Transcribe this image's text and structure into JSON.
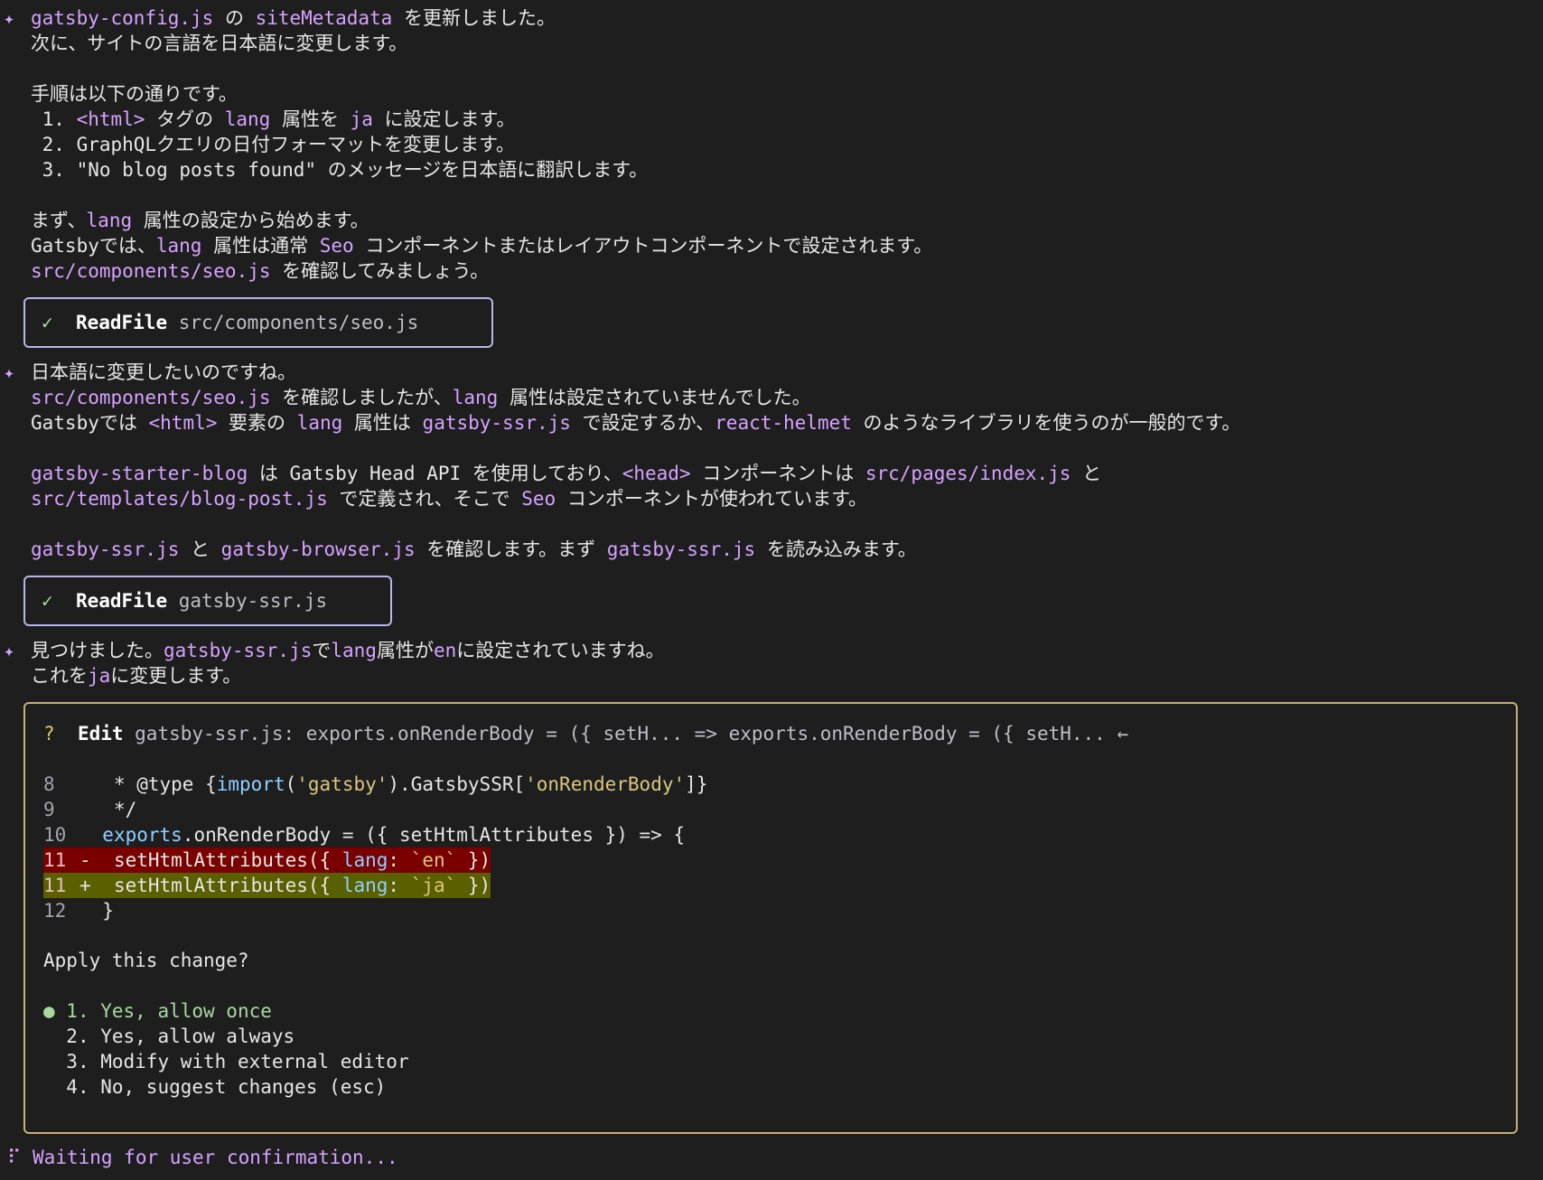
{
  "messages": [
    {
      "lines": [
        [
          {
            "t": "gatsby-config.js",
            "c": "p"
          },
          {
            "t": " の ",
            "c": "w"
          },
          {
            "t": "siteMetadata",
            "c": "p"
          },
          {
            "t": " を更新しました。",
            "c": "w"
          }
        ],
        [
          {
            "t": "次に、サイトの言語を日本語に変更します。",
            "c": "w"
          }
        ],
        [],
        [
          {
            "t": "手順は以下の通りです。",
            "c": "w"
          }
        ],
        [
          {
            "t": " 1. ",
            "c": "w"
          },
          {
            "t": "<html>",
            "c": "p"
          },
          {
            "t": " タグの ",
            "c": "w"
          },
          {
            "t": "lang",
            "c": "p"
          },
          {
            "t": " 属性を ",
            "c": "w"
          },
          {
            "t": "ja",
            "c": "p"
          },
          {
            "t": " に設定します。",
            "c": "w"
          }
        ],
        [
          {
            "t": " 2. GraphQLクエリの日付フォーマットを変更します。",
            "c": "w"
          }
        ],
        [
          {
            "t": " 3. \"No blog posts found\" のメッセージを日本語に翻訳します。",
            "c": "w"
          }
        ],
        [],
        [
          {
            "t": "まず、",
            "c": "w"
          },
          {
            "t": "lang",
            "c": "p"
          },
          {
            "t": " 属性の設定から始めます。",
            "c": "w"
          }
        ],
        [
          {
            "t": "Gatsbyでは、",
            "c": "w"
          },
          {
            "t": "lang",
            "c": "p"
          },
          {
            "t": " 属性は通常 ",
            "c": "w"
          },
          {
            "t": "Seo",
            "c": "p"
          },
          {
            "t": " コンポーネントまたはレイアウトコンポーネントで設定されます。",
            "c": "w"
          }
        ],
        [
          {
            "t": "src/components/seo.js",
            "c": "p"
          },
          {
            "t": " を確認してみましょう。",
            "c": "w"
          }
        ]
      ]
    },
    {
      "lines": [
        [
          {
            "t": "日本語に変更したいのですね。",
            "c": "w"
          }
        ],
        [
          {
            "t": "src/components/seo.js",
            "c": "p"
          },
          {
            "t": " を確認しましたが、",
            "c": "w"
          },
          {
            "t": "lang",
            "c": "p"
          },
          {
            "t": " 属性は設定されていませんでした。",
            "c": "w"
          }
        ],
        [
          {
            "t": "Gatsbyでは ",
            "c": "w"
          },
          {
            "t": "<html>",
            "c": "p"
          },
          {
            "t": " 要素の ",
            "c": "w"
          },
          {
            "t": "lang",
            "c": "p"
          },
          {
            "t": " 属性は ",
            "c": "w"
          },
          {
            "t": "gatsby-ssr.js",
            "c": "p"
          },
          {
            "t": " で設定するか、",
            "c": "w"
          },
          {
            "t": "react-helmet",
            "c": "p"
          },
          {
            "t": " のようなライブラリを使うのが一般的です。",
            "c": "w"
          }
        ],
        [],
        [
          {
            "t": "gatsby-starter-blog",
            "c": "p"
          },
          {
            "t": " は Gatsby Head API を使用しており、",
            "c": "w"
          },
          {
            "t": "<head>",
            "c": "p"
          },
          {
            "t": " コンポーネントは ",
            "c": "w"
          },
          {
            "t": "src/pages/index.js",
            "c": "p"
          },
          {
            "t": " と",
            "c": "w"
          }
        ],
        [
          {
            "t": "src/templates/blog-post.js",
            "c": "p"
          },
          {
            "t": " で定義され、そこで ",
            "c": "w"
          },
          {
            "t": "Seo",
            "c": "p"
          },
          {
            "t": " コンポーネントが使われています。",
            "c": "w"
          }
        ],
        [],
        [
          {
            "t": "gatsby-ssr.js",
            "c": "p"
          },
          {
            "t": " と ",
            "c": "w"
          },
          {
            "t": "gatsby-browser.js",
            "c": "p"
          },
          {
            "t": " を確認します。まず ",
            "c": "w"
          },
          {
            "t": "gatsby-ssr.js",
            "c": "p"
          },
          {
            "t": " を読み込みます。",
            "c": "w"
          }
        ]
      ]
    },
    {
      "lines": [
        [
          {
            "t": "見つけました。",
            "c": "w"
          },
          {
            "t": "gatsby-ssr.js",
            "c": "p"
          },
          {
            "t": "で",
            "c": "w"
          },
          {
            "t": "lang",
            "c": "p"
          },
          {
            "t": "属性が",
            "c": "w"
          },
          {
            "t": "en",
            "c": "p"
          },
          {
            "t": "に設定されていますね。",
            "c": "w"
          }
        ],
        [
          {
            "t": "これを",
            "c": "w"
          },
          {
            "t": "ja",
            "c": "p"
          },
          {
            "t": "に変更します。",
            "c": "w"
          }
        ]
      ]
    }
  ],
  "star_glyph": "✦",
  "tool_calls": [
    {
      "check": "✓",
      "tool": "ReadFile",
      "arg": "src/components/seo.js"
    },
    {
      "check": "✓",
      "tool": "ReadFile",
      "arg": "gatsby-ssr.js"
    }
  ],
  "edit": {
    "marker": "?",
    "tool": "Edit",
    "description": "gatsby-ssr.js: exports.onRenderBody = ({ setH... => exports.onRenderBody = ({ setH... ←",
    "diff": [
      {
        "num": "8",
        "sign": " ",
        "kind": "ctx",
        "code": [
          {
            "t": "  * @type {",
            "c": "w"
          },
          {
            "t": "import",
            "c": "b"
          },
          {
            "t": "(",
            "c": "w"
          },
          {
            "t": "'gatsby'",
            "c": "y"
          },
          {
            "t": ").GatsbySSR[",
            "c": "w"
          },
          {
            "t": "'onRenderBody'",
            "c": "y"
          },
          {
            "t": "]}",
            "c": "w"
          }
        ]
      },
      {
        "num": "9",
        "sign": " ",
        "kind": "ctx",
        "code": [
          {
            "t": "  */",
            "c": "w"
          }
        ]
      },
      {
        "num": "10",
        "sign": " ",
        "kind": "ctx",
        "code": [
          {
            "t": " exports",
            "c": "b"
          },
          {
            "t": ".onRenderBody = ({ setHtmlAttributes }) => {",
            "c": "w"
          }
        ]
      },
      {
        "num": "11",
        "sign": "-",
        "kind": "del",
        "code": [
          {
            "t": "  setHtmlAttributes({ ",
            "c": "w"
          },
          {
            "t": "lang",
            "c": "b"
          },
          {
            "t": ": ",
            "c": "w"
          },
          {
            "t": "`en`",
            "c": "y"
          },
          {
            "t": " })",
            "c": "w"
          }
        ]
      },
      {
        "num": "11",
        "sign": "+",
        "kind": "add",
        "code": [
          {
            "t": "  setHtmlAttributes({ ",
            "c": "w"
          },
          {
            "t": "lang",
            "c": "b"
          },
          {
            "t": ": ",
            "c": "w"
          },
          {
            "t": "`ja`",
            "c": "y"
          },
          {
            "t": " })",
            "c": "w"
          }
        ]
      },
      {
        "num": "12",
        "sign": " ",
        "kind": "ctx",
        "code": [
          {
            "t": " }",
            "c": "w"
          }
        ]
      }
    ],
    "prompt": "Apply this change?",
    "options": [
      {
        "label": "1. Yes, allow once",
        "selected": true
      },
      {
        "label": "2. Yes, allow always",
        "selected": false
      },
      {
        "label": "3. Modify with external editor",
        "selected": false
      },
      {
        "label": "4. No, suggest changes (esc)",
        "selected": false
      }
    ],
    "radio_glyph": "●"
  },
  "status": {
    "spinner": "⠏",
    "text": "Waiting for user confirmation..."
  }
}
